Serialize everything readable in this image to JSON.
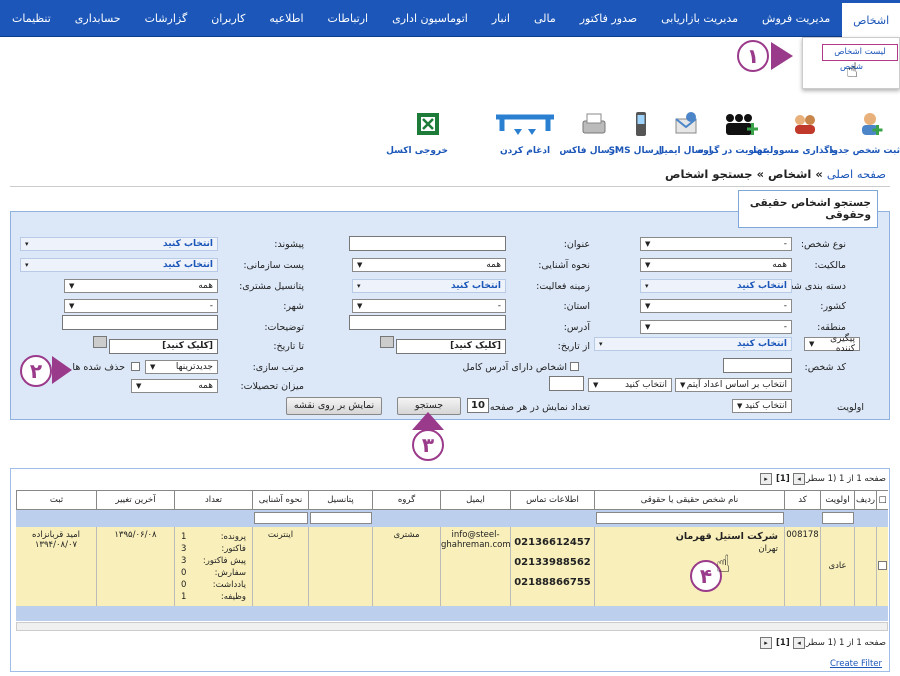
{
  "nav": {
    "items": [
      "اشخاص",
      "مدیریت فروش",
      "مدیریت بازاریابی",
      "صدور فاکتور",
      "مالی",
      "انبار",
      "اتوماسیون اداری",
      "ارتباطات",
      "اطلاعیه",
      "کاربران",
      "گزارشات",
      "حسابداری",
      "تنظیمات"
    ],
    "active": "اشخاص"
  },
  "dropdown": {
    "item1": "لیست اشخاص",
    "item2": "شخص"
  },
  "callouts": {
    "c1": "۱",
    "c2": "۲",
    "c3": "۳",
    "c4": "۴"
  },
  "toolbar": {
    "add_person": "ثبت شخص جدید",
    "assign": "واگذاری مسوولیتها",
    "group": "عضویت در گروه",
    "email": "ارسال ایمیل",
    "sms": "ارسال SMS",
    "fax": "ارسال فاکس",
    "merge": "ادغام کردن",
    "excel": "خروجی اکسل"
  },
  "breadcrumb": {
    "home": "صفحه اصلی",
    "sep": "»",
    "section": "اشخاص",
    "page": "جستجو اشخاص"
  },
  "search": {
    "title": "جستجو اشخاص حقیقی وحقوقی",
    "labels": {
      "person_type": "نوع شخص:",
      "title": "عنوان:",
      "prefix": "پیشوند:",
      "ownership": "مالکیت:",
      "acquaint": "نحوه آشنایی:",
      "org_post": "پست سازمانی:",
      "category": "دسته بندی شخص:",
      "activity": "زمینه فعالیت:",
      "potential": "پتانسیل مشتری:",
      "country": "کشور:",
      "province": "استان:",
      "city": "شهر:",
      "region": "منطقه:",
      "address": "آدرس:",
      "notes": "توضیحات:",
      "followup": "پیگیری کننده",
      "from_date": "از تاریخ:",
      "to_date": "تا تاریخ:",
      "person_code": "کد شخص:",
      "full_address": "اشخاص دارای آدرس کامل",
      "sort": "مرتب سازی:",
      "deleted": "حذف شده ها",
      "education": "میزان تحصیلات:",
      "priority": "اولویت",
      "per_page": "تعداد نمایش در هر صفحه:"
    },
    "values": {
      "dash": "-",
      "choose": "انتخاب کنید",
      "all": "همه",
      "click": "[کلیک کنید]",
      "sort_val": "جدیدترینها",
      "sort_by": "انتخاب بر اساس اعداد آیتم",
      "per_page": "10"
    },
    "buttons": {
      "search": "جستجو",
      "map": "نمایش بر روی نقشه"
    }
  },
  "grid": {
    "pager": "صفحه 1 از 1 (1 سطر)",
    "page_num": "[1]",
    "headers": {
      "row": "ردیف",
      "priority": "اولویت",
      "code": "کد",
      "name": "نام شخص حقیقی یا حقوقی",
      "contact": "اطلاعات تماس",
      "email": "ایمیل",
      "group": "گروه",
      "potential": "پتانسیل",
      "acquaint": "نحوه آشنایی",
      "count": "تعداد",
      "last_change": "آخرین تغییر",
      "reg": "ثبت"
    },
    "row": {
      "code": "008178",
      "priority": "عادی",
      "name": "شرکت استیل قهرمان",
      "city": "تهران",
      "phones": [
        "02136612457",
        "02133988562",
        "02188866755"
      ],
      "email1": "info@steel-",
      "email2": "ghahreman.com",
      "group": "مشتری",
      "acquaint": "اینترنت",
      "counts": [
        "پرونده:",
        "فاکتور:",
        "پیش فاکتور:",
        "سفارش:",
        "یادداشت:",
        "وظیفه:"
      ],
      "count_vals": [
        "1",
        "3",
        "3",
        "0",
        "0",
        "1"
      ],
      "last_change": "۱۳۹۵/۰۶/۰۸",
      "reg_user": "امید قربانزاده",
      "reg_date": "۱۳۹۴/۰۸/۰۷"
    },
    "create_filter": "Create Filter"
  }
}
